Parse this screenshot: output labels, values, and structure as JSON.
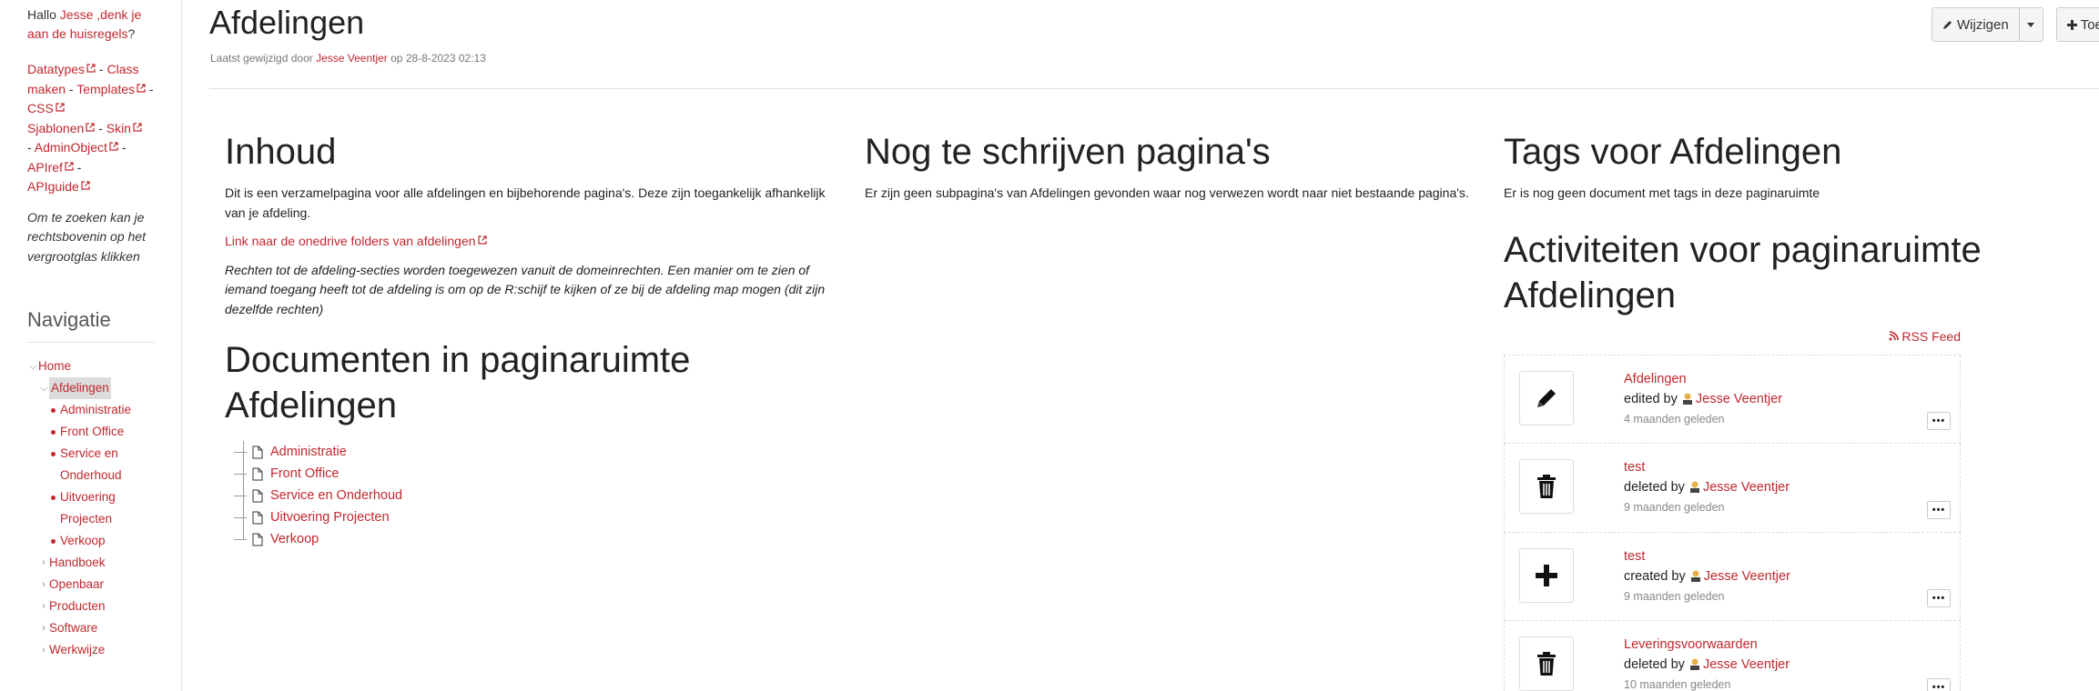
{
  "sidebar": {
    "greeting_prefix": "Hallo ",
    "user_name": "Jesse ,denk je aan de huisregels",
    "greeting_suffix": "?",
    "dev_links": [
      {
        "label": "Datatypes"
      },
      {
        "label": "Class maken"
      },
      {
        "label": "Templates"
      },
      {
        "label": "CSS"
      },
      {
        "label": "Sjablonen"
      },
      {
        "label": "Skin"
      },
      {
        "label": "AdminObject"
      },
      {
        "label": "APIref"
      },
      {
        "label": "APIguide"
      }
    ],
    "search_hint": "Om te zoeken kan je rechtsbovenin op het vergrootglas klikken",
    "nav_title": "Navigatie",
    "nav": {
      "home": "Home",
      "current": "Afdelingen",
      "children": [
        "Administratie",
        "Front Office",
        "Service en Onderhoud",
        "Uitvoering Projecten",
        "Verkoop"
      ],
      "siblings": [
        "Handboek",
        "Openbaar",
        "Producten",
        "Software",
        "Werkwijze"
      ]
    }
  },
  "header": {
    "title": "Afdelingen",
    "meta_prefix": "Laatst gewijzigd door ",
    "meta_author": "Jesse Veentjer",
    "meta_suffix": " op 28-8-2023 02:13",
    "edit_label": "Wijzigen",
    "add_label": "Toe"
  },
  "content": {
    "heading": "Inhoud",
    "intro": "Dit is een verzamelpagina voor alle afdelingen en bijbehorende pagina's. Deze zijn toegankelijk afhankelijk van je afdeling.",
    "onedrive_link": "Link naar de onedrive folders van afdelingen",
    "rights_note": "Rechten tot de afdeling-secties worden toegewezen vanuit de domeinrechten. Een manier om te zien of iemand toegang heeft tot de afdeling is om op de R:schijf te kijken of ze bij de afdeling map mogen (dit zijn dezelfde rechten)",
    "docs_heading": "Documenten in paginaruimte Afdelingen",
    "docs": [
      "Administratie",
      "Front Office",
      "Service en Onderhoud",
      "Uitvoering Projecten",
      "Verkoop"
    ]
  },
  "todo": {
    "heading": "Nog te schrijven pagina's",
    "text": "Er zijn geen subpagina's van Afdelingen gevonden waar nog verwezen wordt naar niet bestaande pagina's."
  },
  "tags": {
    "heading": "Tags voor Afdelingen",
    "empty": "Er is nog geen document met tags in deze paginaruimte"
  },
  "activity": {
    "heading": "Activiteiten voor paginaruimte Afdelingen",
    "rss_label": "RSS Feed",
    "items": [
      {
        "icon": "pencil-icon",
        "title": "Afdelingen",
        "action": "edited by ",
        "user": "Jesse Veentjer",
        "when": "4 maanden geleden"
      },
      {
        "icon": "trash-icon",
        "title": "test",
        "action": "deleted by ",
        "user": "Jesse Veentjer",
        "when": "9 maanden geleden"
      },
      {
        "icon": "plus-icon",
        "title": "test",
        "action": "created by ",
        "user": "Jesse Veentjer",
        "when": "9 maanden geleden"
      },
      {
        "icon": "trash-icon",
        "title": "Leveringsvoorwaarden",
        "action": "deleted by ",
        "user": "Jesse Veentjer",
        "when": "10 maanden geleden"
      }
    ],
    "more_label": "•••"
  }
}
